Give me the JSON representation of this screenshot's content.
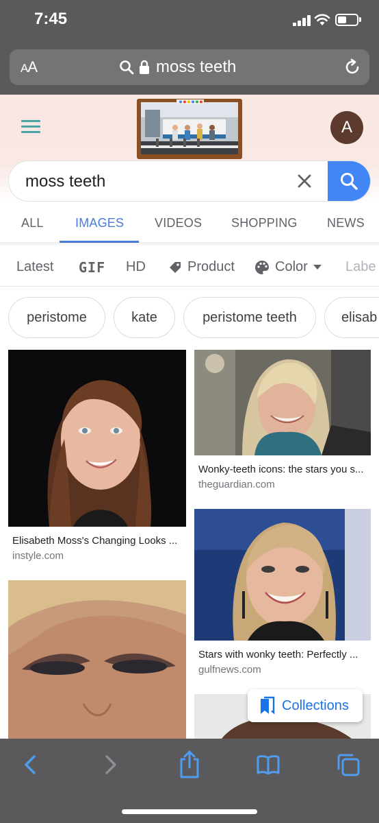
{
  "status_bar": {
    "time": "7:45",
    "battery_level": 0.45
  },
  "browser": {
    "text_size_label_small": "A",
    "text_size_label_large": "A",
    "url_display": "moss teeth"
  },
  "google": {
    "avatar_letter": "A",
    "search_value": "moss teeth",
    "tabs": [
      {
        "label": "ALL",
        "active": false
      },
      {
        "label": "IMAGES",
        "active": true
      },
      {
        "label": "VIDEOS",
        "active": false
      },
      {
        "label": "SHOPPING",
        "active": false
      },
      {
        "label": "NEWS",
        "active": false
      }
    ],
    "filters": [
      {
        "label": "Latest"
      },
      {
        "label": "GIF"
      },
      {
        "label": "HD"
      },
      {
        "label": "Product",
        "icon": "tag-icon"
      },
      {
        "label": "Color",
        "icon": "palette-icon"
      },
      {
        "label": "Labe"
      }
    ],
    "related_chips": [
      "peristome",
      "kate",
      "peristome teeth",
      "elisab"
    ],
    "results": [
      {
        "caption": "Elisabeth Moss's Changing Looks ...",
        "source": "instyle.com"
      },
      {
        "caption": "Wonky-teeth icons: the stars you s...",
        "source": "theguardian.com"
      },
      {
        "caption": "Stars with wonky teeth: Perfectly ...",
        "source": "gulfnews.com"
      },
      {
        "caption": "",
        "source": ""
      },
      {
        "caption": "",
        "source": ""
      }
    ],
    "collections_label": "Collections"
  },
  "colors": {
    "accent_blue": "#4285f4",
    "active_tab": "#4a7bd9",
    "hamburger_teal": "#4aa3a5",
    "browser_chrome": "#5a5a5c"
  }
}
